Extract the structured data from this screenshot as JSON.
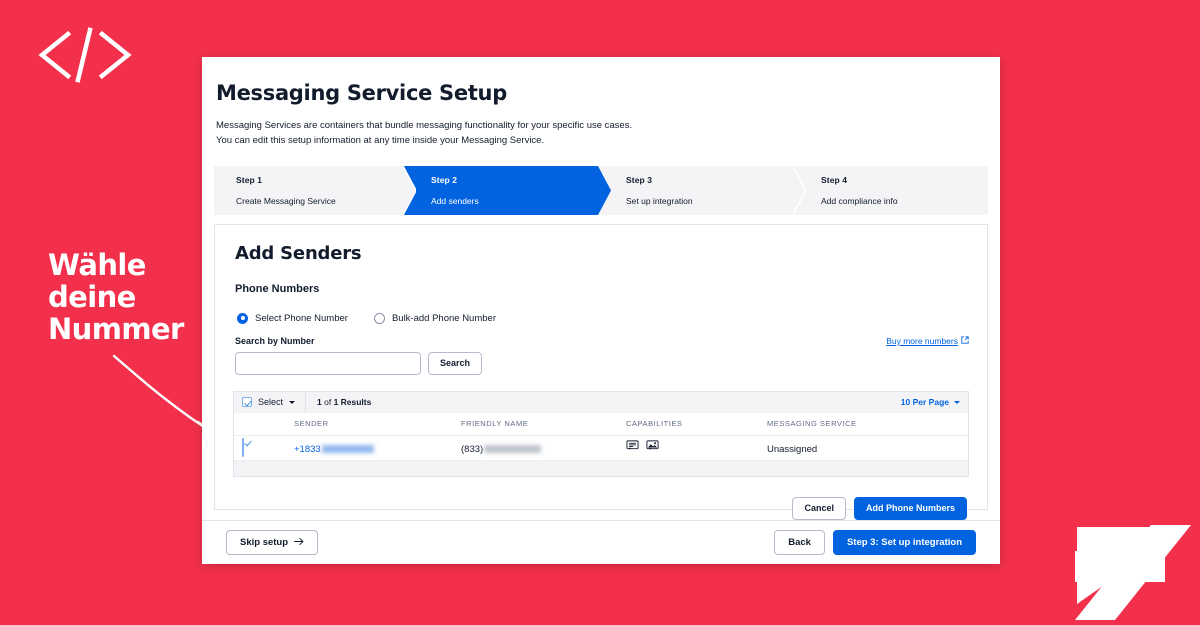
{
  "theme": {
    "background_red": "#F2304B",
    "accent_blue": "#0263E0",
    "text_dark": "#121C2D",
    "muted_grey": "#606B85"
  },
  "decor": {
    "code_icon": "code-brackets-icon",
    "corner_icon": "twilio-arrow-mark-icon"
  },
  "annotation": {
    "text": "Wähle\ndeine\nNummer",
    "arrow": "curved-arrow-icon"
  },
  "header": {
    "title": "Messaging Service Setup",
    "description_line1": "Messaging Services are containers that bundle messaging functionality for your specific use cases.",
    "description_line2": "You can edit this setup information at any time inside your Messaging Service."
  },
  "stepper": {
    "steps": [
      {
        "num": "Step 1",
        "label": "Create Messaging Service",
        "active": false
      },
      {
        "num": "Step 2",
        "label": "Add senders",
        "active": true
      },
      {
        "num": "Step 3",
        "label": "Set up integration",
        "active": false
      },
      {
        "num": "Step 4",
        "label": "Add compliance info",
        "active": false
      }
    ]
  },
  "panel": {
    "title": "Add Senders",
    "section_title": "Phone Numbers",
    "radios": [
      {
        "label": "Select Phone Number",
        "checked": true
      },
      {
        "label": "Bulk-add Phone Number",
        "checked": false
      }
    ],
    "search": {
      "label": "Search by Number",
      "value": "",
      "placeholder": "",
      "button_label": "Search"
    },
    "buy_link": {
      "label": "Buy more numbers",
      "icon": "external-link-icon"
    },
    "table": {
      "toolbar": {
        "select_label": "Select",
        "select_checked": true,
        "results_prefix": "1",
        "results_middle": " of ",
        "results_suffix": "1 Results",
        "per_page_label": "10 Per Page"
      },
      "columns": [
        "SENDER",
        "FRIENDLY NAME",
        "CAPABILITIES",
        "MESSAGING SERVICE"
      ],
      "rows": [
        {
          "selected": true,
          "sender": "+1833",
          "sender_redacted": true,
          "friendly_name": "(833)",
          "friendly_name_redacted": true,
          "capabilities": [
            "sms-icon",
            "mms-icon"
          ],
          "messaging_service": "Unassigned"
        }
      ]
    },
    "actions": {
      "cancel_label": "Cancel",
      "submit_label": "Add Phone Numbers"
    }
  },
  "footer": {
    "skip_label": "Skip setup",
    "skip_icon": "arrow-right-icon",
    "back_label": "Back",
    "next_label": "Step 3: Set up integration"
  }
}
